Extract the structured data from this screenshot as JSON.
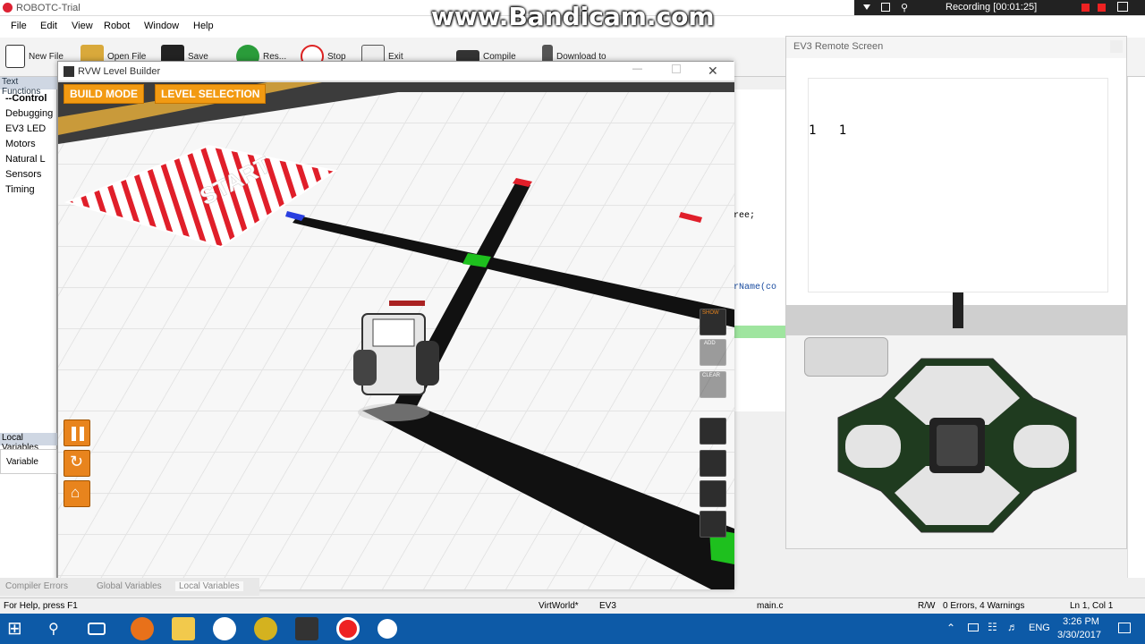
{
  "app_title": "ROBOTC-Trial",
  "watermark": "www.Bandicam.com",
  "recording": "Recording [00:01:25]",
  "menu": [
    "File",
    "Edit",
    "View",
    "Robot",
    "Window",
    "Help"
  ],
  "toolbar": {
    "new_file": "New File",
    "open_file": "Open File",
    "save": "Save",
    "resume": "Res...",
    "stop": "Stop",
    "exit": "Exit",
    "compile": "Compile",
    "download": "Download to"
  },
  "left_panel": {
    "header": "Text Functions",
    "items": [
      "--Control",
      "Debugging",
      "EV3 LED",
      "Motors",
      "Natural L",
      "Sensors",
      "Timing"
    ],
    "local_vars_header": "Local Variables",
    "variable_col": "Variable"
  },
  "code_snippets": [
    "ree;",
    "rName(co"
  ],
  "bottom_tabs": [
    "Compiler Errors",
    "Global Variables",
    "Local Variables"
  ],
  "status": {
    "help": "For Help, press F1",
    "world": "VirtWorld*",
    "platform": "EV3",
    "file": "main.c",
    "rw": "R/W",
    "errors": "0 Errors, 4 Warnings",
    "position": "Ln 1, Col 1"
  },
  "rvw": {
    "title": "RVW Level Builder",
    "build_mode": "BUILD MODE",
    "level_selection": "LEVEL SELECTION",
    "start_label": "START",
    "side_buttons": [
      "SHOW",
      "ADD",
      "CLEAR"
    ]
  },
  "ev3": {
    "title": "EV3 Remote Screen",
    "screen_text": "1   1"
  },
  "taskbar": {
    "lang": "ENG",
    "time": "3:26 PM",
    "date": "3/30/2017"
  }
}
